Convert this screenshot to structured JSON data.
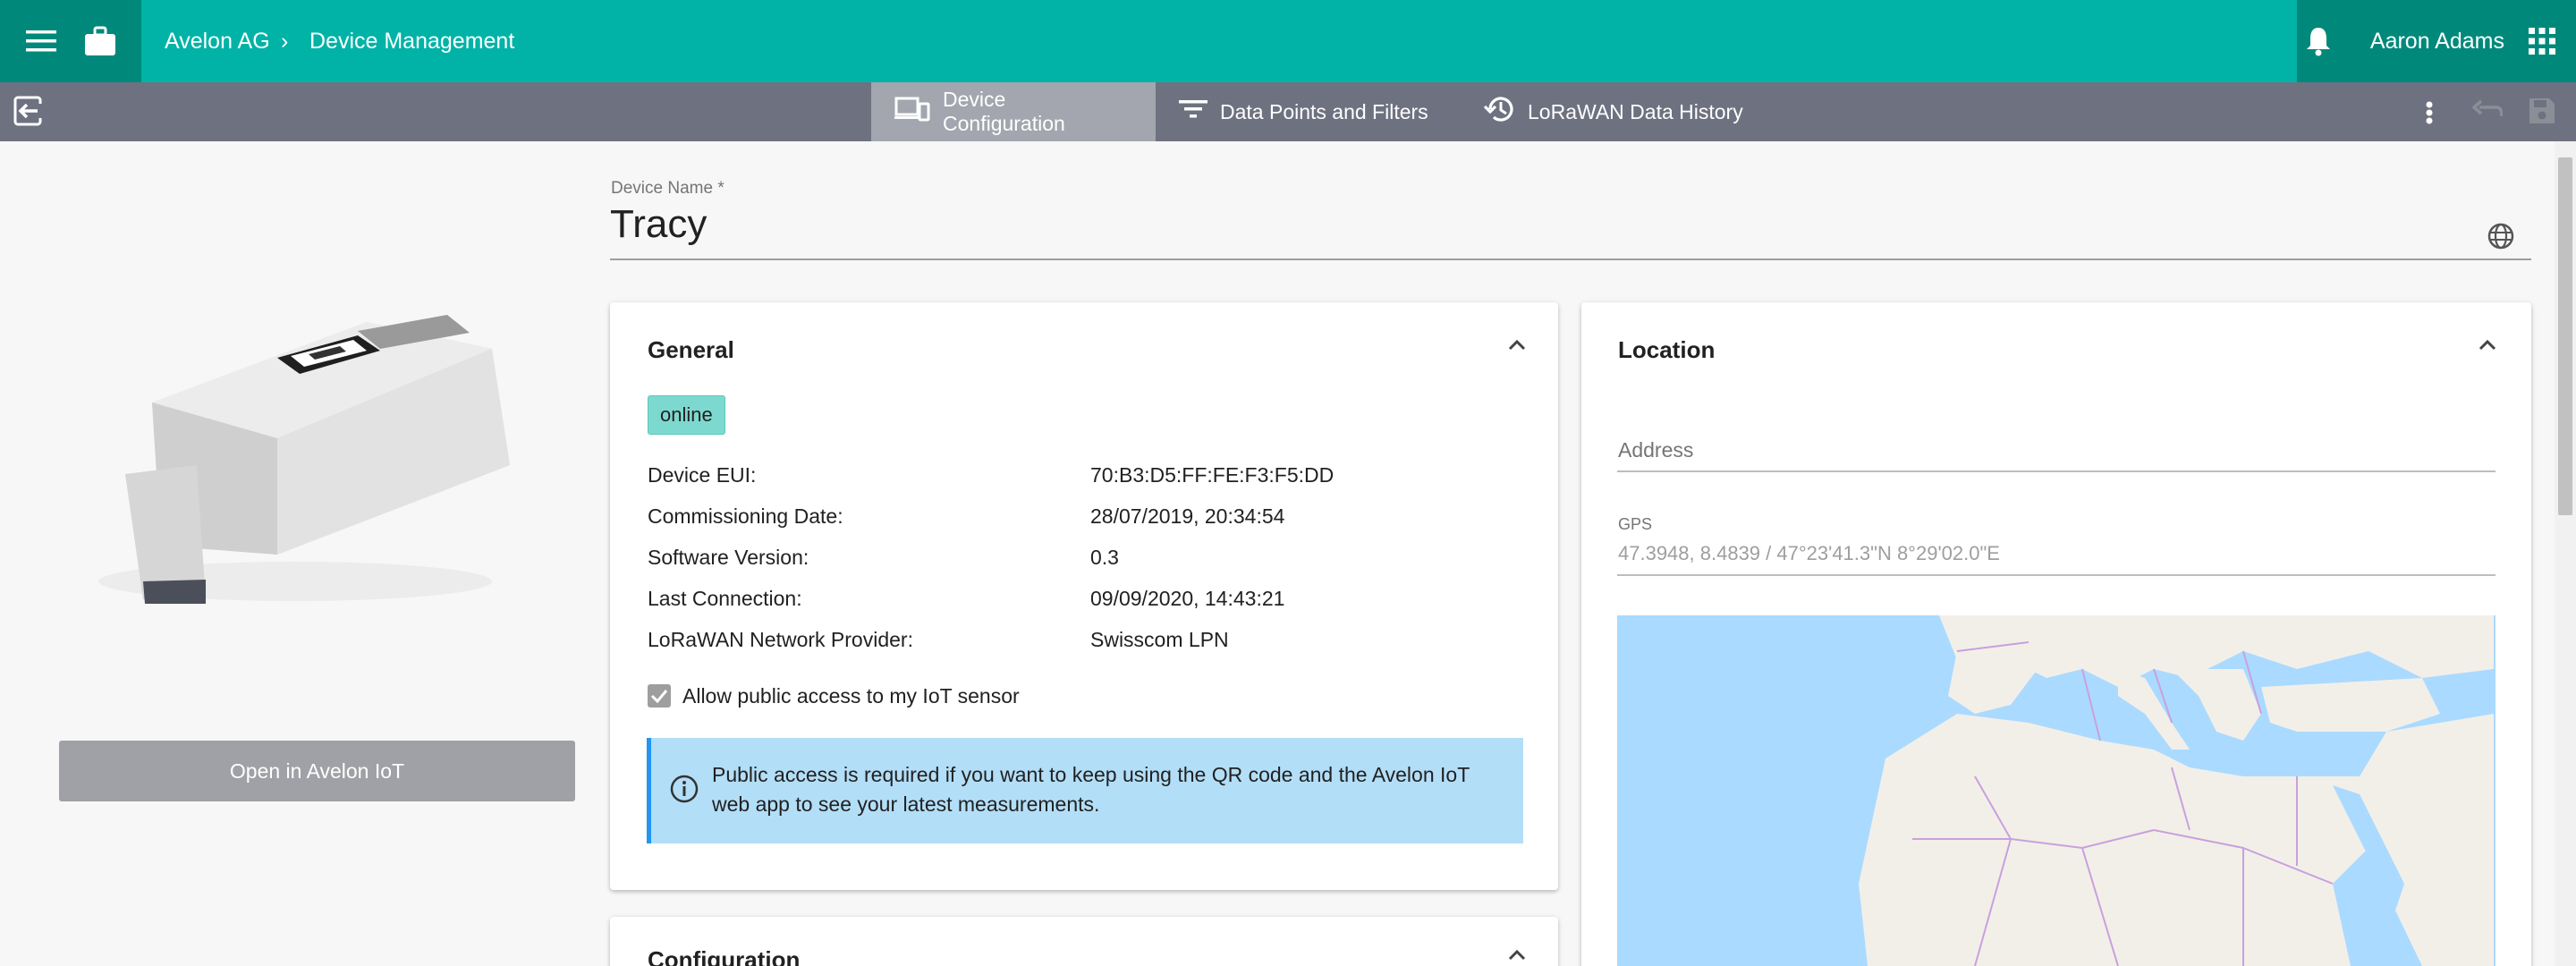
{
  "header": {
    "org": "Avelon AG",
    "separator": "›",
    "section": "Device Management",
    "user": "Aaron Adams"
  },
  "tabs": [
    {
      "label": "Device Configuration",
      "icon": "devices-icon",
      "active": true
    },
    {
      "label": "Data Points and Filters",
      "icon": "filter-icon",
      "active": false
    },
    {
      "label": "LoRaWAN Data History",
      "icon": "history-icon",
      "active": false
    }
  ],
  "left": {
    "open_button": "Open in Avelon IoT"
  },
  "device": {
    "name_label": "Device Name *",
    "name": "Tracy"
  },
  "general": {
    "title": "General",
    "status": "online",
    "rows": [
      {
        "label": "Device EUI:",
        "value": "70:B3:D5:FF:FE:F3:F5:DD"
      },
      {
        "label": "Commissioning Date:",
        "value": "28/07/2019, 20:34:54"
      },
      {
        "label": "Software Version:",
        "value": "0.3"
      },
      {
        "label": "Last Connection:",
        "value": "09/09/2020, 14:43:21"
      },
      {
        "label": "LoRaWAN Network Provider:",
        "value": "Swisscom LPN"
      }
    ],
    "public_access_label": "Allow public access to my IoT sensor",
    "public_access_checked": true,
    "info_text": "Public access is required if you want to keep using the QR code and the Avelon IoT web app to see your latest measurements."
  },
  "configuration": {
    "title": "Configuration"
  },
  "location": {
    "title": "Location",
    "address_placeholder": "Address",
    "gps_label": "GPS",
    "gps_value": "47.3948, 8.4839  /  47°23'41.3\"N 8°29'02.0\"E"
  },
  "colors": {
    "header": "#00b3a6",
    "header_dark": "#00897b",
    "tabbar": "#6e7280",
    "status_badge": "#7dd9cf",
    "info_box": "#b3def7",
    "map_water": "#aadaff",
    "map_land": "#f2efe9"
  }
}
